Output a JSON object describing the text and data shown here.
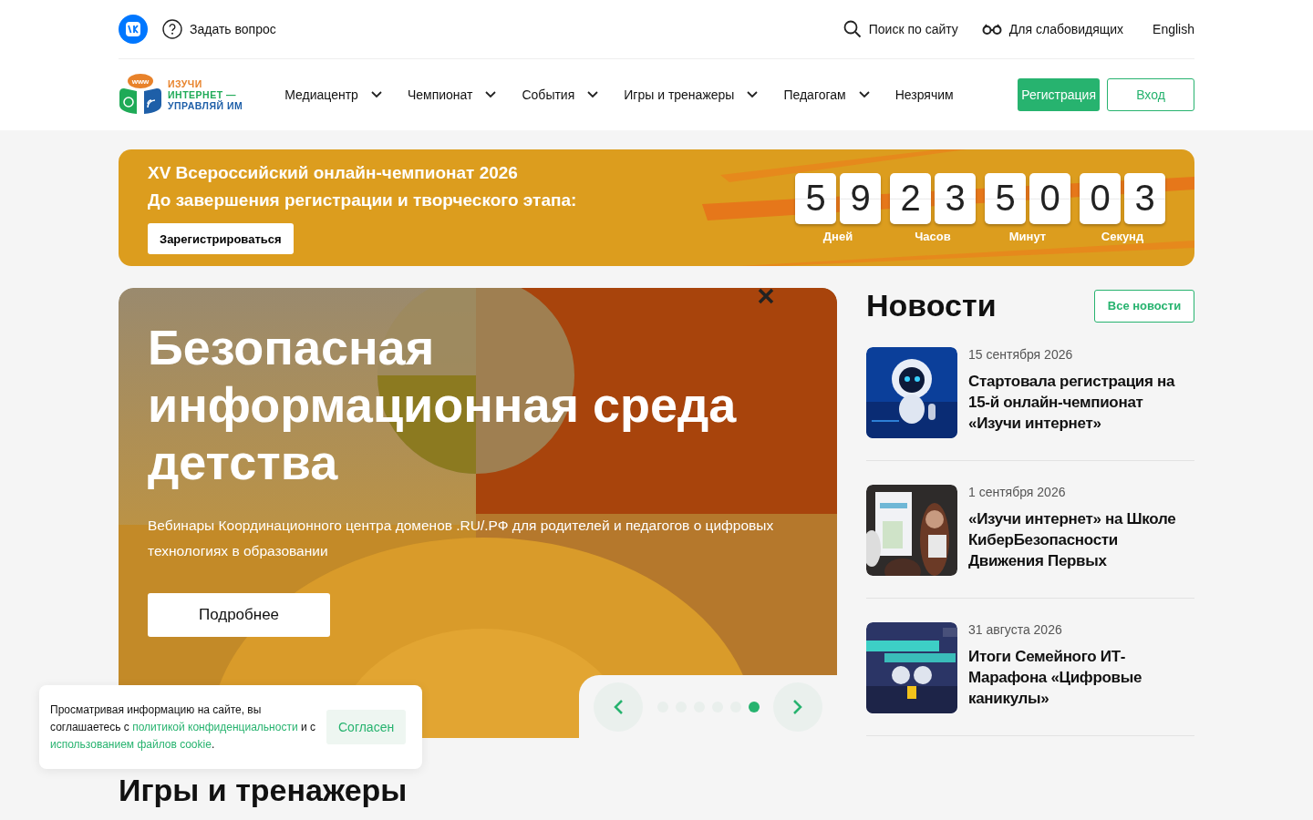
{
  "topbar": {
    "ask": "Задать вопрос",
    "search": "Поиск по сайту",
    "accessibility": "Для слабовидящих",
    "language": "English"
  },
  "logo": {
    "badge": "www",
    "lines": [
      "ИЗУЧИ",
      "ИНТЕРНЕТ —",
      "УПРАВЛЯЙ ИМ"
    ]
  },
  "nav": [
    {
      "label": "Медиацентр",
      "dropdown": true
    },
    {
      "label": "Чемпионат",
      "dropdown": true
    },
    {
      "label": "События",
      "dropdown": true
    },
    {
      "label": "Игры и тренажеры",
      "dropdown": true
    },
    {
      "label": "Педагогам",
      "dropdown": true
    },
    {
      "label": "Незрячим",
      "dropdown": false
    }
  ],
  "auth": {
    "register": "Регистрация",
    "login": "Вход"
  },
  "banner": {
    "title": "XV Всероссийский онлайн-чемпионат 2026",
    "subtitle": "До завершения регистрации и творческого этапа:",
    "button": "Зарегистрироваться",
    "countdown": [
      {
        "digits": [
          "5",
          "9"
        ],
        "label": "Дней"
      },
      {
        "digits": [
          "2",
          "3"
        ],
        "label": "Часов"
      },
      {
        "digits": [
          "5",
          "0"
        ],
        "label": "Минут"
      },
      {
        "digits": [
          "0",
          "3"
        ],
        "label": "Секунд"
      }
    ]
  },
  "slider": {
    "title": "Безопасная информационная среда детства",
    "text": "Вебинары Координационного центра доменов .RU/.РФ для родителей и педагогов о цифровых технологиях в образовании",
    "button": "Подробнее",
    "dots": [
      {
        "selected": false
      },
      {
        "selected": false
      },
      {
        "selected": false
      },
      {
        "selected": false
      },
      {
        "selected": false
      },
      {
        "selected": true
      }
    ]
  },
  "news": {
    "heading": "Новости",
    "all": "Все новости",
    "items": [
      {
        "date": "15 сентября 2026",
        "title": "Стартовала регистрация на 15-й онлайн-чемпионат «Изучи интернет»",
        "kind": "picture"
      },
      {
        "date": "1 сентября 2026",
        "title": "«Изучи интернет» на Школе КиберБезопасности Движения Первых",
        "kind": "picture"
      },
      {
        "date": "31 августа 2026",
        "title": "Итоги Семейного ИТ-Марафона «Цифровые каникулы»",
        "kind": "picture"
      }
    ]
  },
  "section_heading": "Игры и тренажеры",
  "cookie": {
    "parts": [
      {
        "text": "Просматривая информацию на сайте, вы соглашаетесь с ",
        "kind": "text"
      },
      {
        "text": "политикой конфиденциальности",
        "kind": "link"
      },
      {
        "text": " и с ",
        "kind": "text"
      },
      {
        "text": "использованием файлов cookie",
        "kind": "link"
      },
      {
        "text": ".",
        "kind": "text"
      }
    ],
    "button": "Согласен"
  }
}
